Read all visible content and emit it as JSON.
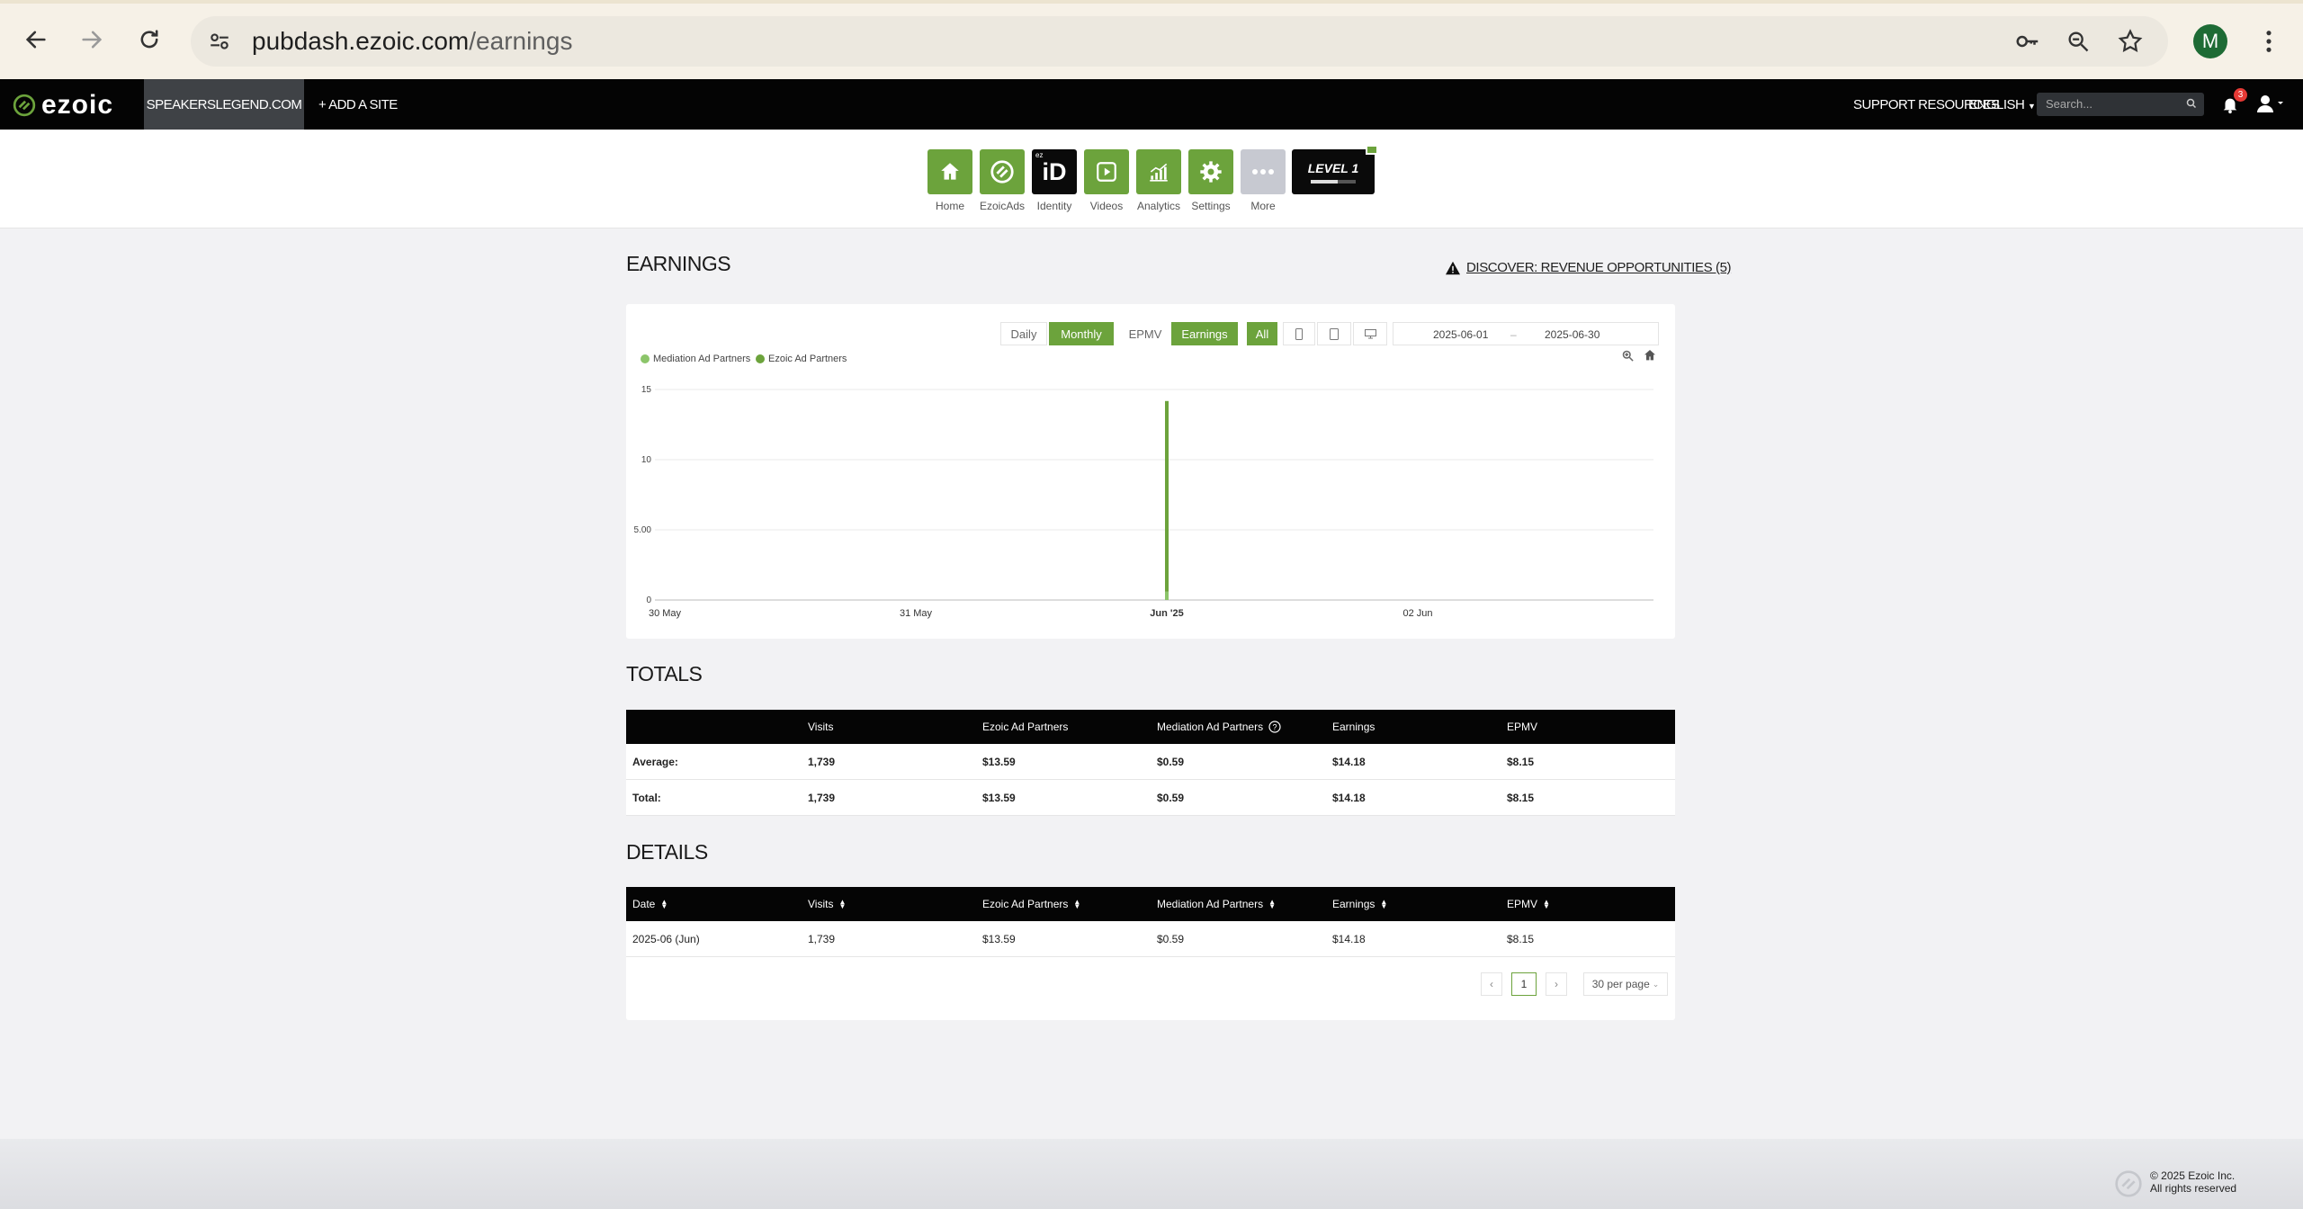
{
  "browser": {
    "url_host": "pubdash.ezoic.com",
    "url_path": "/earnings",
    "profile_initial": "M"
  },
  "header": {
    "logo": "ezoic",
    "site": "SPEAKERSLEGEND.COM",
    "add_site": "+ ADD A SITE",
    "support": "SUPPORT RESOURCES",
    "language": "ENGLISH",
    "search_placeholder": "Search...",
    "notifications": "3"
  },
  "nav": {
    "items": [
      {
        "label": "Home",
        "icon": "home-icon",
        "color": "#6ca33c"
      },
      {
        "label": "EzoicAds",
        "icon": "ezoicads-icon",
        "color": "#6ca33c"
      },
      {
        "label": "Identity",
        "icon": "identity-icon",
        "color": "#0a0a0a"
      },
      {
        "label": "Videos",
        "icon": "video-icon",
        "color": "#6ca33c"
      },
      {
        "label": "Analytics",
        "icon": "analytics-icon",
        "color": "#6ca33c"
      },
      {
        "label": "Settings",
        "icon": "gear-icon",
        "color": "#6ca33c"
      },
      {
        "label": "More",
        "icon": "more-icon",
        "color": "#c7c9d1"
      }
    ],
    "identity_text": "iD",
    "identity_small": "ez",
    "level": "LEVEL 1",
    "level_progress": 0.6
  },
  "earnings": {
    "title": "EARNINGS",
    "discover": "DISCOVER: REVENUE OPPORTUNITIES (5)"
  },
  "toolbar": {
    "daily": "Daily",
    "monthly": "Monthly",
    "epmv": "EPMV",
    "earnings": "Earnings",
    "all": "All",
    "date_from": "2025-06-01",
    "date_sep": "–",
    "date_to": "2025-06-30"
  },
  "chart_data": {
    "type": "bar",
    "series": [
      {
        "name": "Mediation Ad Partners",
        "color": "#8cc56a",
        "values": [
          0.59
        ]
      },
      {
        "name": "Ezoic Ad Partners",
        "color": "#6ca33c",
        "values": [
          13.59
        ]
      }
    ],
    "x": [
      "Jun '25"
    ],
    "x_ticks": [
      "30 May",
      "31 May",
      "Jun '25",
      "02 Jun"
    ],
    "y_ticks": [
      "0",
      "5.00",
      "10",
      "15"
    ],
    "ylim": [
      0,
      15
    ],
    "grid": true,
    "legend": "top-left"
  },
  "totals": {
    "title": "TOTALS",
    "columns": [
      "",
      "Visits",
      "Ezoic Ad Partners",
      "Mediation Ad Partners",
      "Earnings",
      "EPMV"
    ],
    "rows": [
      [
        "Average:",
        "1,739",
        "$13.59",
        "$0.59",
        "$14.18",
        "$8.15"
      ],
      [
        "Total:",
        "1,739",
        "$13.59",
        "$0.59",
        "$14.18",
        "$8.15"
      ]
    ]
  },
  "details": {
    "title": "DETAILS",
    "columns": [
      "Date",
      "Visits",
      "Ezoic Ad Partners",
      "Mediation Ad Partners",
      "Earnings",
      "EPMV"
    ],
    "rows": [
      [
        "2025-06 (Jun)",
        "1,739",
        "$13.59",
        "$0.59",
        "$14.18",
        "$8.15"
      ]
    ],
    "page": "1",
    "per_page": "30 per page"
  },
  "footer": {
    "line1": "© 2025 Ezoic Inc.",
    "line2": "All rights reserved"
  }
}
